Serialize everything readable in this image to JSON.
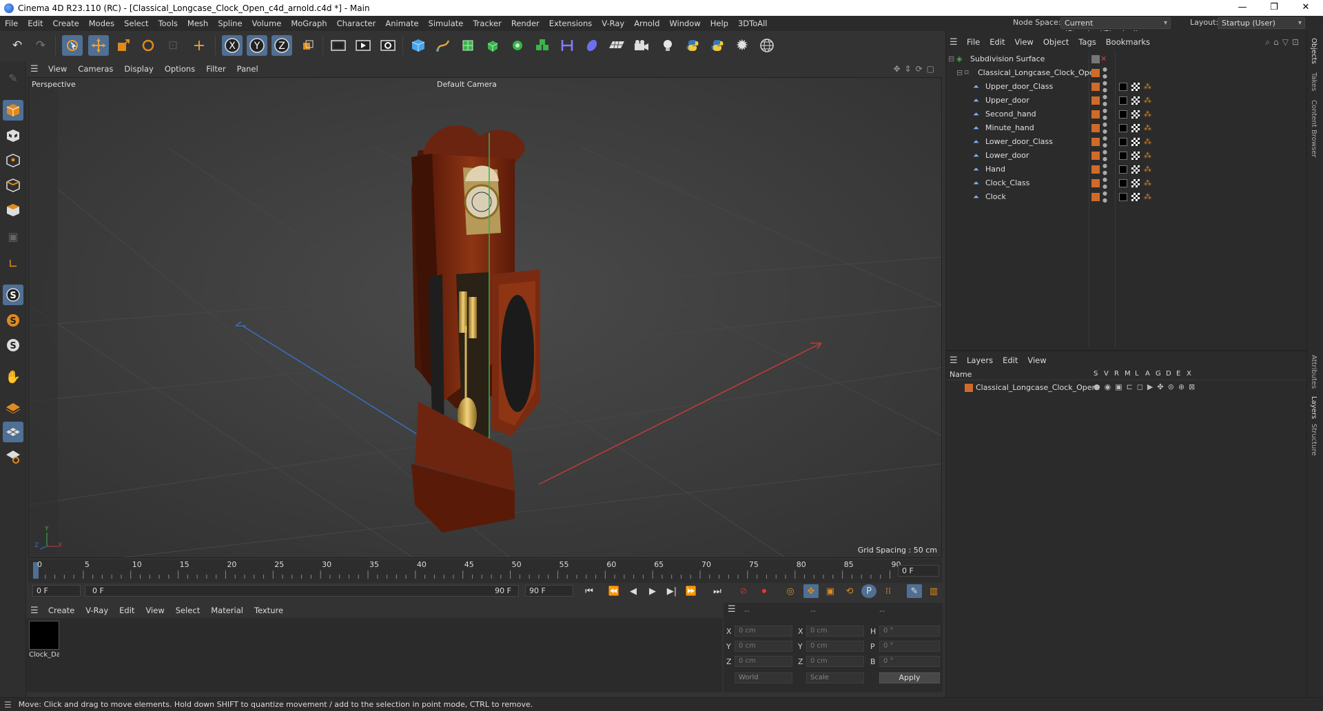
{
  "window": {
    "title": "Cinema 4D R23.110 (RC) - [Classical_Longcase_Clock_Open_c4d_arnold.c4d *] - Main",
    "minimize": "—",
    "maximize": "❐",
    "close": "✕"
  },
  "menubar": {
    "items": [
      "File",
      "Edit",
      "Create",
      "Modes",
      "Select",
      "Tools",
      "Mesh",
      "Spline",
      "Volume",
      "MoGraph",
      "Character",
      "Animate",
      "Simulate",
      "Tracker",
      "Render",
      "Extensions",
      "V-Ray",
      "Arnold",
      "Window",
      "Help",
      "3DToAll"
    ],
    "node_space_label": "Node Space:",
    "node_space_value": "Current (Standard/Physical)",
    "layout_label": "Layout:",
    "layout_value": "Startup (User)"
  },
  "viewport": {
    "menu": [
      "View",
      "Cameras",
      "Display",
      "Options",
      "Filter",
      "Panel"
    ],
    "projection": "Perspective",
    "camera": "Default Camera",
    "grid_spacing": "Grid Spacing : 50 cm",
    "axis_y": "Y",
    "axis_z": "Z",
    "axis_x": "X"
  },
  "timeline": {
    "ticks": [
      "0",
      "5",
      "10",
      "15",
      "20",
      "25",
      "30",
      "35",
      "40",
      "45",
      "50",
      "55",
      "60",
      "65",
      "70",
      "75",
      "80",
      "85",
      "90"
    ],
    "current_frame": "0 F",
    "start_field": "0 F",
    "range_start": "0 F",
    "range_end": "90 F",
    "end_field": "90 F"
  },
  "materials": {
    "menu": [
      "Create",
      "V-Ray",
      "Edit",
      "View",
      "Select",
      "Material",
      "Texture"
    ],
    "items": [
      {
        "name": "Clock_Da"
      }
    ]
  },
  "attributes": {
    "header": [
      "--",
      "--",
      "--"
    ],
    "rows": [
      {
        "a": "X",
        "av": "0 cm",
        "b": "X",
        "bv": "0 cm",
        "c": "H",
        "cv": "0 °"
      },
      {
        "a": "Y",
        "av": "0 cm",
        "b": "Y",
        "bv": "0 cm",
        "c": "P",
        "cv": "0 °"
      },
      {
        "a": "Z",
        "av": "0 cm",
        "b": "Z",
        "bv": "0 cm",
        "c": "B",
        "cv": "0 °"
      }
    ],
    "coord_system": "World",
    "mode": "Scale",
    "apply_label": "Apply"
  },
  "status": "Move: Click and drag to move elements. Hold down SHIFT to quantize movement / add to the selection in point mode, CTRL to remove.",
  "objects": {
    "menu": [
      "File",
      "Edit",
      "View",
      "Object",
      "Tags",
      "Bookmarks"
    ],
    "root": "Subdivision Surface",
    "group": "Classical_Longcase_Clock_Open",
    "children": [
      "Upper_door_Class",
      "Upper_door",
      "Second_hand",
      "Minute_hand",
      "Lower_door_Class",
      "Lower_door",
      "Hand",
      "Clock_Class",
      "Clock"
    ]
  },
  "layers": {
    "menu": [
      "Layers",
      "Edit",
      "View"
    ],
    "col_name": "Name",
    "cols": [
      "S",
      "V",
      "R",
      "M",
      "L",
      "A",
      "G",
      "D",
      "E",
      "X"
    ],
    "rows": [
      {
        "name": "Classical_Longcase_Clock_Open"
      }
    ]
  },
  "side_tabs": [
    "Objects",
    "Takes",
    "Content Browser",
    "Attributes",
    "Layers",
    "Structure"
  ],
  "colors": {
    "accent": "#4f6f94",
    "layer": "#d06a2a",
    "axis_x": "#c23a3a",
    "axis_z": "#3a6fc2",
    "axis_y": "#37b24d"
  }
}
